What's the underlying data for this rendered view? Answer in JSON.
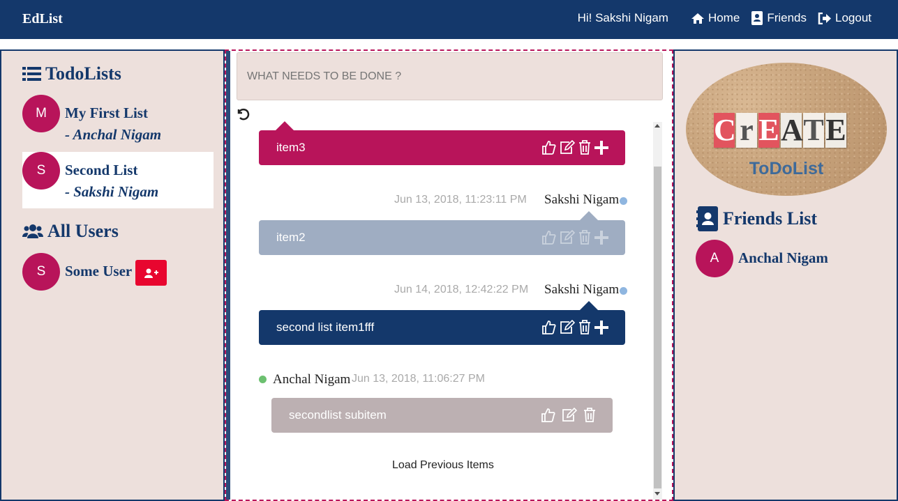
{
  "navbar": {
    "brand": "EdList",
    "greeting": "Hi! Sakshi Nigam",
    "home": "Home",
    "friends": "Friends",
    "logout": "Logout"
  },
  "left": {
    "todolists_heading": "TodoLists",
    "lists": [
      {
        "initial": "M",
        "title": "My First List",
        "owner": "- Anchal Nigam"
      },
      {
        "initial": "S",
        "title": "Second List",
        "owner": "- Sakshi Nigam"
      }
    ],
    "users_heading": "All Users",
    "users": [
      {
        "initial": "S",
        "name": "Some User"
      }
    ]
  },
  "center": {
    "input_placeholder": "WHAT NEEDS TO BE DONE ?",
    "items": [
      {
        "text": "item3",
        "color": "#b8145a"
      },
      {
        "text": "item2",
        "color": "#9fadc2",
        "date": "Jun 13, 2018, 11:23:11 PM",
        "user": "Sakshi Nigam"
      },
      {
        "text": "second list item1fff",
        "color": "#14386b",
        "date": "Jun 14, 2018, 12:42:22 PM",
        "user": "Sakshi Nigam"
      },
      {
        "text": "secondlist subitem",
        "color": "#bcb0b2",
        "date": "Jun 13, 2018, 11:06:27 PM",
        "user": "Anchal Nigam"
      }
    ],
    "load_previous": "Load Previous Items"
  },
  "right": {
    "logo_letters": [
      "C",
      "r",
      "E",
      "A",
      "T",
      "E"
    ],
    "logo_sub": "ToDoList",
    "friends_heading": "Friends List",
    "friends": [
      {
        "initial": "A",
        "name": "Anchal Nigam"
      }
    ]
  },
  "colors": {
    "navy": "#14386b",
    "magenta": "#b8145a",
    "panel_bg": "#ede0dc",
    "add_red": "#e8062f",
    "online_blue": "#8fb6e0",
    "online_green": "#6cc070"
  }
}
